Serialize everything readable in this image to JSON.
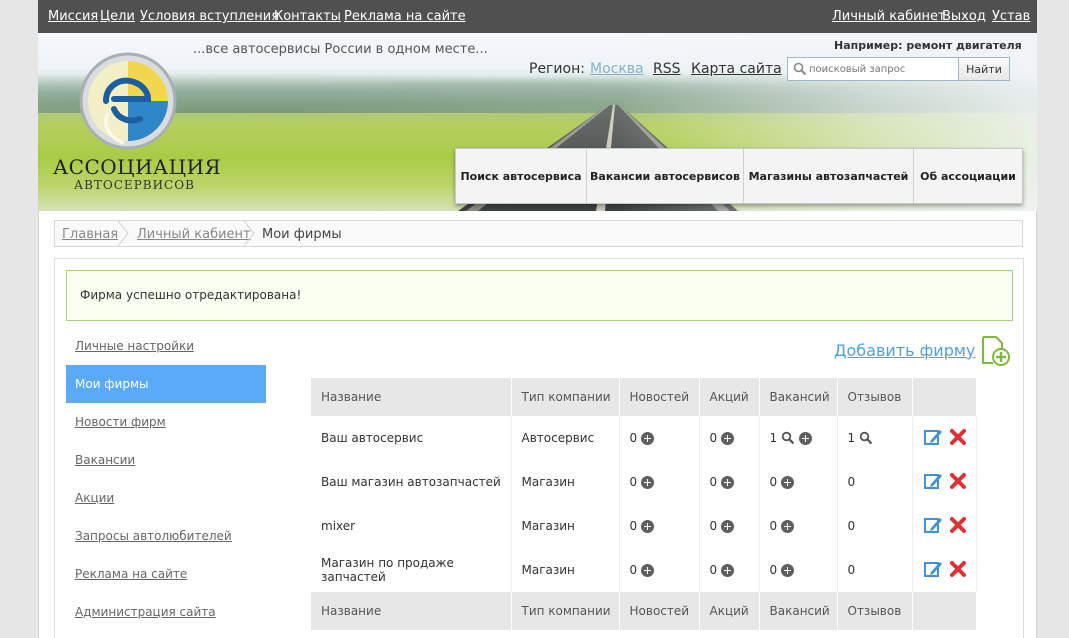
{
  "topbar": {
    "left_links": [
      "Миссия",
      "Цели",
      "Условия вступления",
      "Контакты",
      "Реклама на сайте"
    ],
    "right_links": [
      "Личный кабинет",
      "Выход",
      "Устав"
    ]
  },
  "header": {
    "tagline": "...все автосервисы России в одном месте...",
    "example": "Например: ремонт двигателя",
    "region_label": "Регион:",
    "region_value": "Москва",
    "rss": "RSS",
    "sitemap": "Карта сайта",
    "search_placeholder": "поисковый запрос",
    "search_button": "Найти",
    "logo_name": "АССОЦИАЦИЯ",
    "logo_sub": "АВТОСЕРВИСОВ",
    "nav": [
      "Поиск автосервиса",
      "Вакансии автосервисов",
      "Магазины автозапчастей",
      "Об ассоциации"
    ]
  },
  "breadcrumb": [
    "Главная",
    "Личный кабиент",
    "Мои фирмы"
  ],
  "notice": "Фирма успешно отредактирована!",
  "sidebar": [
    "Личные настройки",
    "Мои фирмы",
    "Новости фирм",
    "Вакансии",
    "Акции",
    "Запросы автолюбителей",
    "Реклама на сайте",
    "Администрация сайта"
  ],
  "sidebar_active": "Мои фирмы",
  "add_firm": "Добавить фирму",
  "table": {
    "columns": [
      "Название",
      "Тип компании",
      "Новостей",
      "Акций",
      "Вакансий",
      "Отзывов"
    ],
    "rows": [
      {
        "name": "Ваш автосервис",
        "type": "Автосервис",
        "news": "0",
        "promos": "0",
        "vacancies": "1",
        "reviews": "1"
      },
      {
        "name": "Ваш магазин автозапчастей",
        "type": "Магазин",
        "news": "0",
        "promos": "0",
        "vacancies": "0",
        "reviews": "0"
      },
      {
        "name": "mixer",
        "type": "Магазин",
        "news": "0",
        "promos": "0",
        "vacancies": "0",
        "reviews": "0"
      },
      {
        "name": "Магазин по продаже запчастей",
        "type": "Магазин",
        "news": "0",
        "promos": "0",
        "vacancies": "0",
        "reviews": "0"
      }
    ]
  },
  "colors": {
    "topbar": "#505050",
    "active_sidebar": "#5aaaf7",
    "link_blue": "#4ba3e4",
    "notice_border": "#a5d27a",
    "delete_red": "#e03030"
  }
}
